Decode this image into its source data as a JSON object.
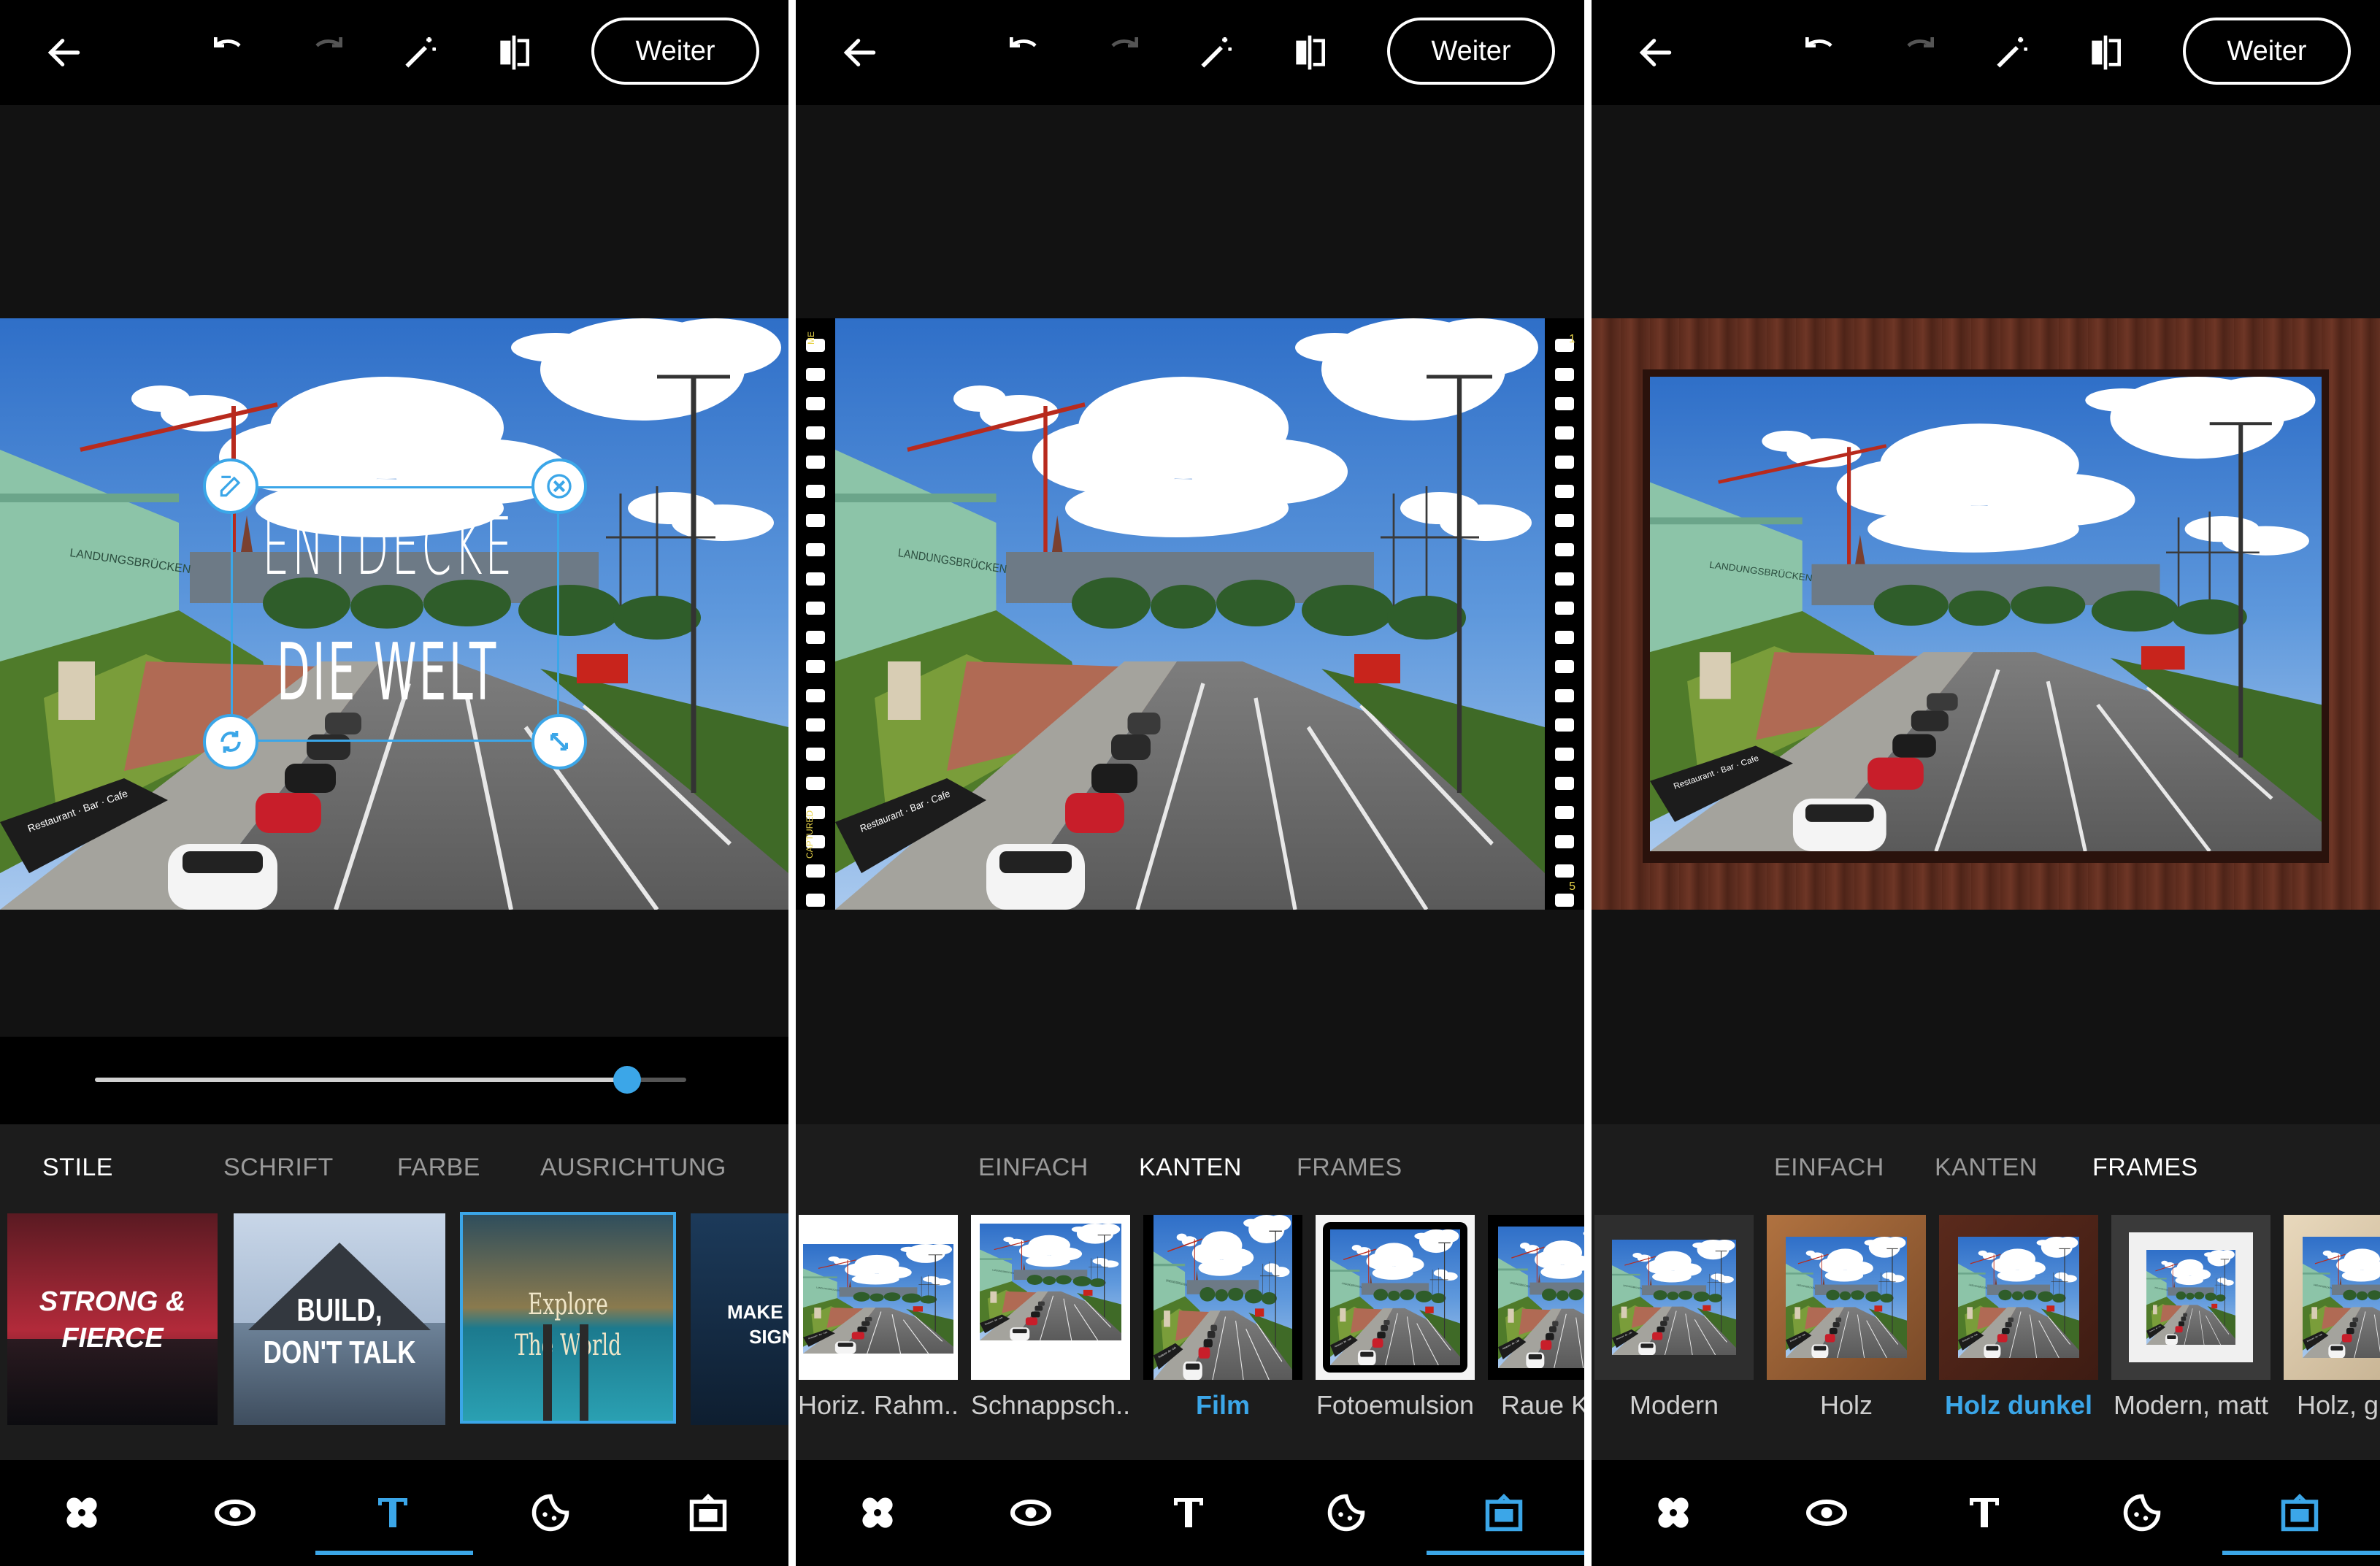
{
  "colors": {
    "accent": "#3ba6e8",
    "topbar": "#000000",
    "panel": "#121212",
    "tray": "#1c1c1c"
  },
  "toolbar": {
    "next_label": "Weiter"
  },
  "panel1": {
    "overlay_text": {
      "line1": "ENTDECKE",
      "line2": "DIE WELT"
    },
    "slider_value": 0.9,
    "tabs": [
      {
        "label": "STILE",
        "active": true
      },
      {
        "label": "SCHRIFT",
        "active": false
      },
      {
        "label": "FARBE",
        "active": false
      },
      {
        "label": "AUSRICHTUNG",
        "active": false
      }
    ],
    "styles": [
      {
        "line1": "STRONG &",
        "line2": "FIERCE"
      },
      {
        "line1": "BUILD,",
        "line2": "DON'T TALK"
      },
      {
        "line1": "Explore",
        "line2": "The World"
      },
      {
        "line1": "MAKE IT S",
        "line2": "SIGN"
      }
    ]
  },
  "panel2": {
    "tabs": [
      {
        "label": "EINFACH",
        "active": false
      },
      {
        "label": "KANTEN",
        "active": true
      },
      {
        "label": "FRAMES",
        "active": false
      }
    ],
    "items": [
      "Horiz. Rahm..",
      "Schnappsch..",
      "Film",
      "Fotoemulsion",
      "Raue K"
    ],
    "selected": "Film",
    "film_marks": {
      "top_left": "ME",
      "bottom_left": "CAPTURED",
      "top_right": "1",
      "bottom_right": "5"
    }
  },
  "panel3": {
    "tabs": [
      {
        "label": "EINFACH",
        "active": false
      },
      {
        "label": "KANTEN",
        "active": false
      },
      {
        "label": "FRAMES",
        "active": true
      }
    ],
    "items": [
      "Modern",
      "Holz",
      "Holz dunkel",
      "Modern, matt",
      "Holz, g"
    ],
    "selected": "Holz dunkel"
  },
  "bottom_nav": [
    "bandage-icon",
    "eye-icon",
    "text-icon",
    "sticker-icon",
    "frame-icon"
  ],
  "photo": {
    "sign_text": "LANDUNGSBRÜCKEN",
    "awning_text": "Restaurant · Bar · Cafe"
  }
}
